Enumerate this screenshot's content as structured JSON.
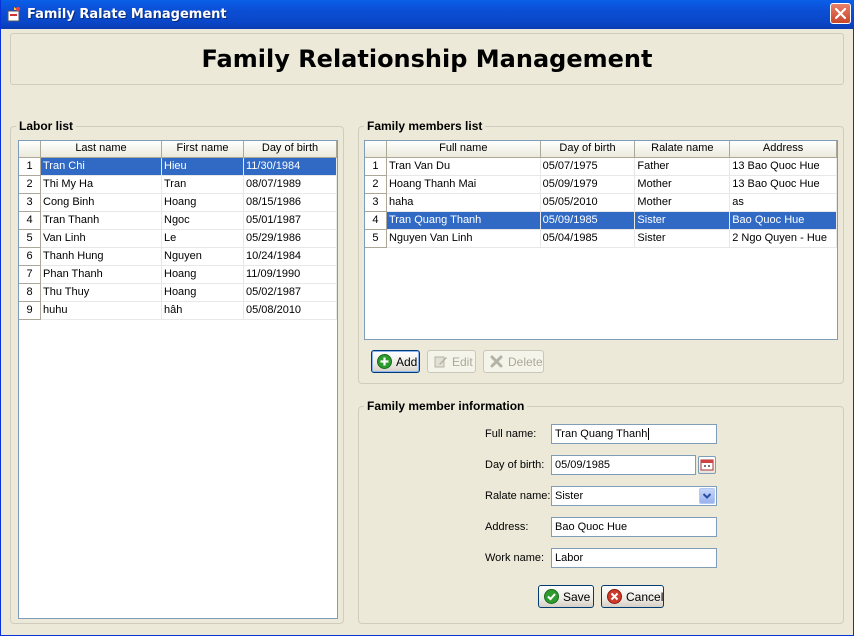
{
  "window": {
    "title": "Family Ralate Management"
  },
  "header": {
    "title": "Family Relationship Management"
  },
  "labor_list": {
    "title": "Labor list",
    "columns": [
      "Last name",
      "First name",
      "Day of birth"
    ],
    "selected_index": 0,
    "rows": [
      {
        "num": "1",
        "last": "Tran Chi",
        "first": "Hieu",
        "dob": "11/30/1984"
      },
      {
        "num": "2",
        "last": "Thi My Ha",
        "first": "Tran",
        "dob": "08/07/1989"
      },
      {
        "num": "3",
        "last": "Cong Binh",
        "first": "Hoang",
        "dob": "08/15/1986"
      },
      {
        "num": "4",
        "last": "Tran Thanh",
        "first": "Ngoc",
        "dob": "05/01/1987"
      },
      {
        "num": "5",
        "last": "Van Linh",
        "first": "Le",
        "dob": "05/29/1986"
      },
      {
        "num": "6",
        "last": "Thanh Hung",
        "first": "Nguyen",
        "dob": "10/24/1984"
      },
      {
        "num": "7",
        "last": "Phan Thanh",
        "first": "Hoang",
        "dob": "11/09/1990"
      },
      {
        "num": "8",
        "last": "Thu Thuy",
        "first": "Hoang",
        "dob": "05/02/1987"
      },
      {
        "num": "9",
        "last": "huhu",
        "first": "hâh",
        "dob": "05/08/2010"
      }
    ]
  },
  "members_list": {
    "title": "Family members list",
    "columns": [
      "Full name",
      "Day of birth",
      "Ralate name",
      "Address"
    ],
    "selected_index": 3,
    "rows": [
      {
        "num": "1",
        "name": "Tran Van Du",
        "dob": "05/07/1975",
        "relate": "Father",
        "address": "13 Bao Quoc Hue"
      },
      {
        "num": "2",
        "name": "Hoang Thanh Mai",
        "dob": "05/09/1979",
        "relate": "Mother",
        "address": "13 Bao Quoc Hue"
      },
      {
        "num": "3",
        "name": "haha",
        "dob": "05/05/2010",
        "relate": "Mother",
        "address": "as"
      },
      {
        "num": "4",
        "name": "Tran Quang Thanh",
        "dob": "05/09/1985",
        "relate": "Sister",
        "address": "Bao Quoc Hue"
      },
      {
        "num": "5",
        "name": "Nguyen Van Linh",
        "dob": "05/04/1985",
        "relate": "Sister",
        "address": "2 Ngo Quyen - Hue"
      }
    ],
    "buttons": {
      "add": "Add",
      "edit": "Edit",
      "delete": "Delete"
    }
  },
  "member_info": {
    "title": "Family member information",
    "full_name_label": "Full name:",
    "full_name_value": "Tran Quang Thanh",
    "dob_label": "Day of birth:",
    "dob_value": "05/09/1985",
    "relate_label": "Ralate name:",
    "relate_value": "Sister",
    "address_label": "Address:",
    "address_value": "Bao Quoc Hue",
    "work_label": "Work name:",
    "work_value": "Labor",
    "save": "Save",
    "cancel": "Cancel"
  },
  "colors": {
    "selection": "#316AC5",
    "window_bg": "#ECE9D8",
    "titlebar": "#0A5FE8"
  }
}
